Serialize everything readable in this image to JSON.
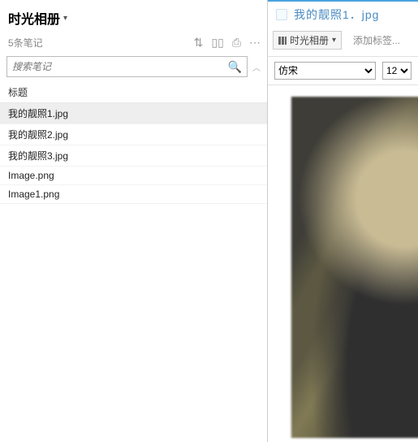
{
  "left": {
    "title": "时光相册",
    "count_label": "5条笔记",
    "search_placeholder": "搜索笔记",
    "column_header": "标题",
    "rows": [
      "我的靓照1.jpg",
      "我的靓照2.jpg",
      "我的靓照3.jpg",
      "Image.png",
      "Image1.png"
    ],
    "selected_index": 0
  },
  "right": {
    "title": "我的靓照1．jpg",
    "notebook_button": "时光相册",
    "add_tag": "添加标签...",
    "font_options": [
      "仿宋"
    ],
    "font_selected": "仿宋",
    "size_options": [
      "12"
    ],
    "size_selected": "12"
  }
}
